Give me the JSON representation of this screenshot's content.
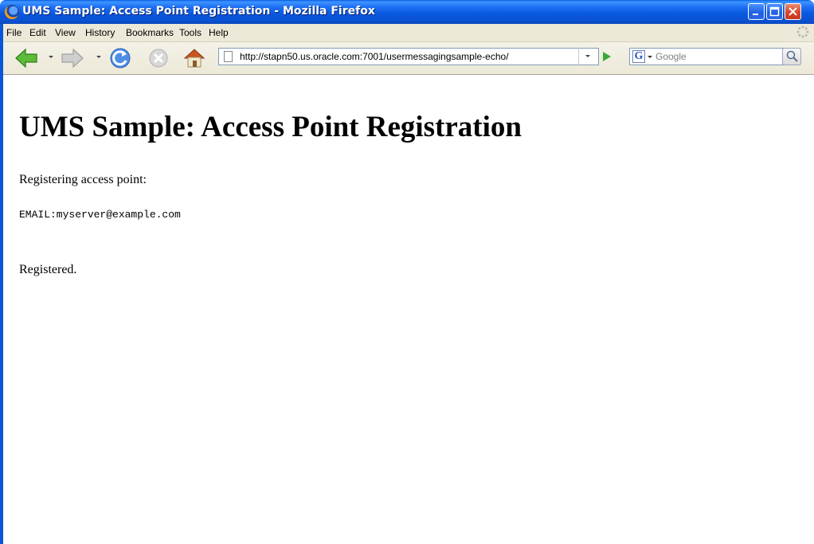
{
  "window": {
    "title": "UMS Sample: Access Point Registration - Mozilla Firefox",
    "accent": "#0a5fe4"
  },
  "menu": {
    "items": [
      "File",
      "Edit",
      "View",
      "History",
      "Bookmarks",
      "Tools",
      "Help"
    ]
  },
  "toolbar": {
    "url": "http://stapn50.us.oracle.com:7001/usermessagingsample-echo/",
    "search_placeholder": "Google",
    "search_engine_glyph": "G"
  },
  "page": {
    "heading": "UMS Sample: Access Point Registration",
    "intro": "Registering access point:",
    "access_point": "EMAIL:myserver@example.com",
    "status": "Registered."
  }
}
